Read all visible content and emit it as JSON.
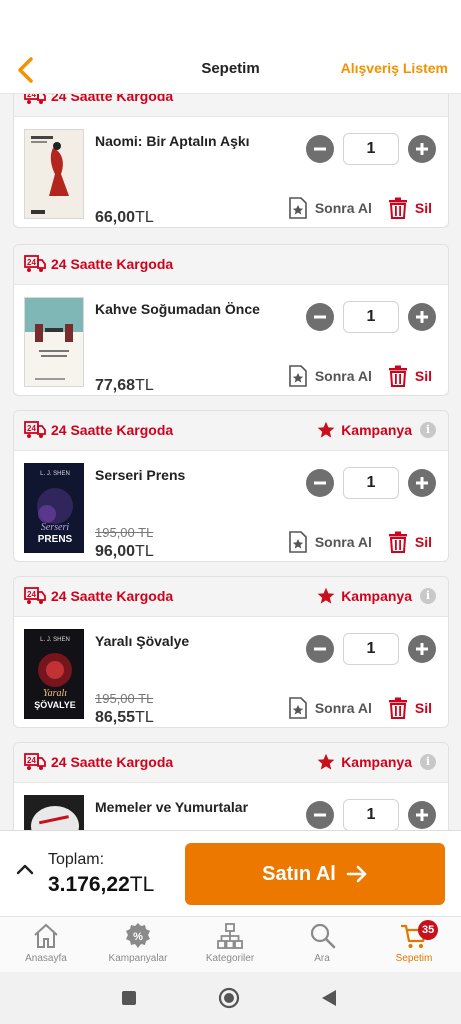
{
  "header": {
    "title": "Sepetim",
    "right_link": "Alışveriş Listem"
  },
  "cart_items": [
    {
      "shipping": "24 Saatte Kargoda",
      "campaign": "",
      "title": "Naomi: Bir Aptalın Aşkı",
      "old_price": "",
      "price": "66,00",
      "currency": "TL",
      "quantity": "1",
      "later_label": "Sonra Al",
      "delete_label": "Sil"
    },
    {
      "shipping": "24 Saatte Kargoda",
      "campaign": "",
      "title": "Kahve Soğumadan Önce",
      "old_price": "",
      "price": "77,68",
      "currency": "TL",
      "quantity": "1",
      "later_label": "Sonra Al",
      "delete_label": "Sil"
    },
    {
      "shipping": "24 Saatte Kargoda",
      "campaign": "Kampanya",
      "title": "Serseri Prens",
      "old_price": "195,00 TL",
      "price": "96,00",
      "currency": "TL",
      "quantity": "1",
      "later_label": "Sonra Al",
      "delete_label": "Sil",
      "cover_author": "L. J. SHEN",
      "cover_title_1": "Serseri",
      "cover_title_2": "PRENS"
    },
    {
      "shipping": "24 Saatte Kargoda",
      "campaign": "Kampanya",
      "title": "Yaralı Şövalye",
      "old_price": "195,00 TL",
      "price": "86,55",
      "currency": "TL",
      "quantity": "1",
      "later_label": "Sonra Al",
      "delete_label": "Sil",
      "cover_author": "L. J. SHEN",
      "cover_title_1": "Yaralı",
      "cover_title_2": "ŞÖVALYE"
    },
    {
      "shipping": "24 Saatte Kargoda",
      "campaign": "Kampanya",
      "title": "Memeler ve Yumurtalar",
      "old_price": "",
      "price": "",
      "currency": "",
      "quantity": "1",
      "later_label": "",
      "delete_label": ""
    }
  ],
  "summary": {
    "total_label": "Toplam:",
    "total_value": "3.176,22",
    "currency": "TL",
    "buy_label": "Satın Al"
  },
  "tabs": [
    {
      "label": "Anasayfa",
      "icon": "home-icon"
    },
    {
      "label": "Kampanyalar",
      "icon": "percent-badge-icon"
    },
    {
      "label": "Kategoriler",
      "icon": "hierarchy-icon"
    },
    {
      "label": "Ara",
      "icon": "search-icon"
    },
    {
      "label": "Sepetim",
      "icon": "cart-icon",
      "badge": "35",
      "active": true
    }
  ],
  "colors": {
    "accent": "#f39200",
    "buy_button": "#ec7800",
    "alert_red": "#d0021b",
    "badge_red": "#c8101c"
  }
}
